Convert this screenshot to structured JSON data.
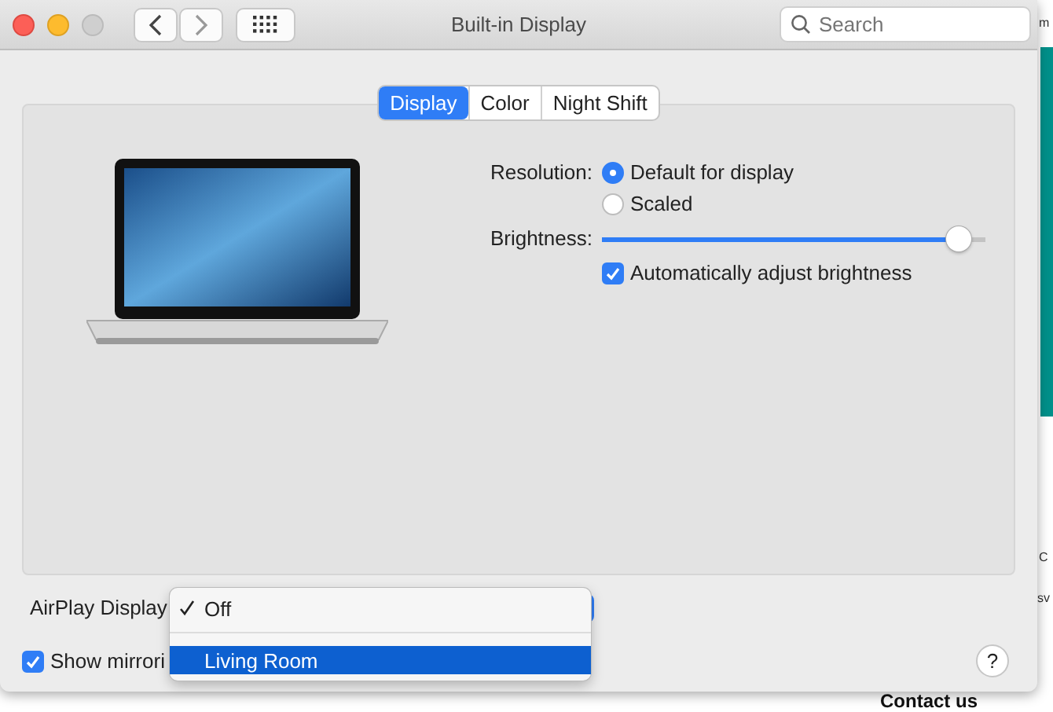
{
  "background_page": {
    "fragments": [
      {
        "text": "m",
        "kind": "small"
      },
      {
        "text": "C",
        "kind": "small"
      },
      {
        "text": "sv",
        "kind": "small"
      },
      {
        "text": "Contact us",
        "kind": "heading"
      }
    ]
  },
  "window": {
    "title": "Built-in Display",
    "search": {
      "placeholder": "Search"
    }
  },
  "tabs": [
    {
      "label": "Display",
      "selected": true
    },
    {
      "label": "Color",
      "selected": false
    },
    {
      "label": "Night Shift",
      "selected": false
    }
  ],
  "resolution": {
    "label": "Resolution:",
    "options": [
      {
        "label": "Default for display",
        "selected": true
      },
      {
        "label": "Scaled",
        "selected": false
      }
    ]
  },
  "brightness": {
    "label": "Brightness:",
    "level": 0.96,
    "auto_adjust": {
      "label": "Automatically adjust brightness",
      "checked": true
    }
  },
  "airplay": {
    "label": "AirPlay Display",
    "menu": [
      {
        "label": "Off",
        "checked": true,
        "selected": false
      },
      {
        "label": "Living Room",
        "checked": false,
        "selected": true
      }
    ]
  },
  "show_mirroring": {
    "label": "Show mirrori",
    "checked": true
  },
  "help": {
    "label": "?"
  }
}
